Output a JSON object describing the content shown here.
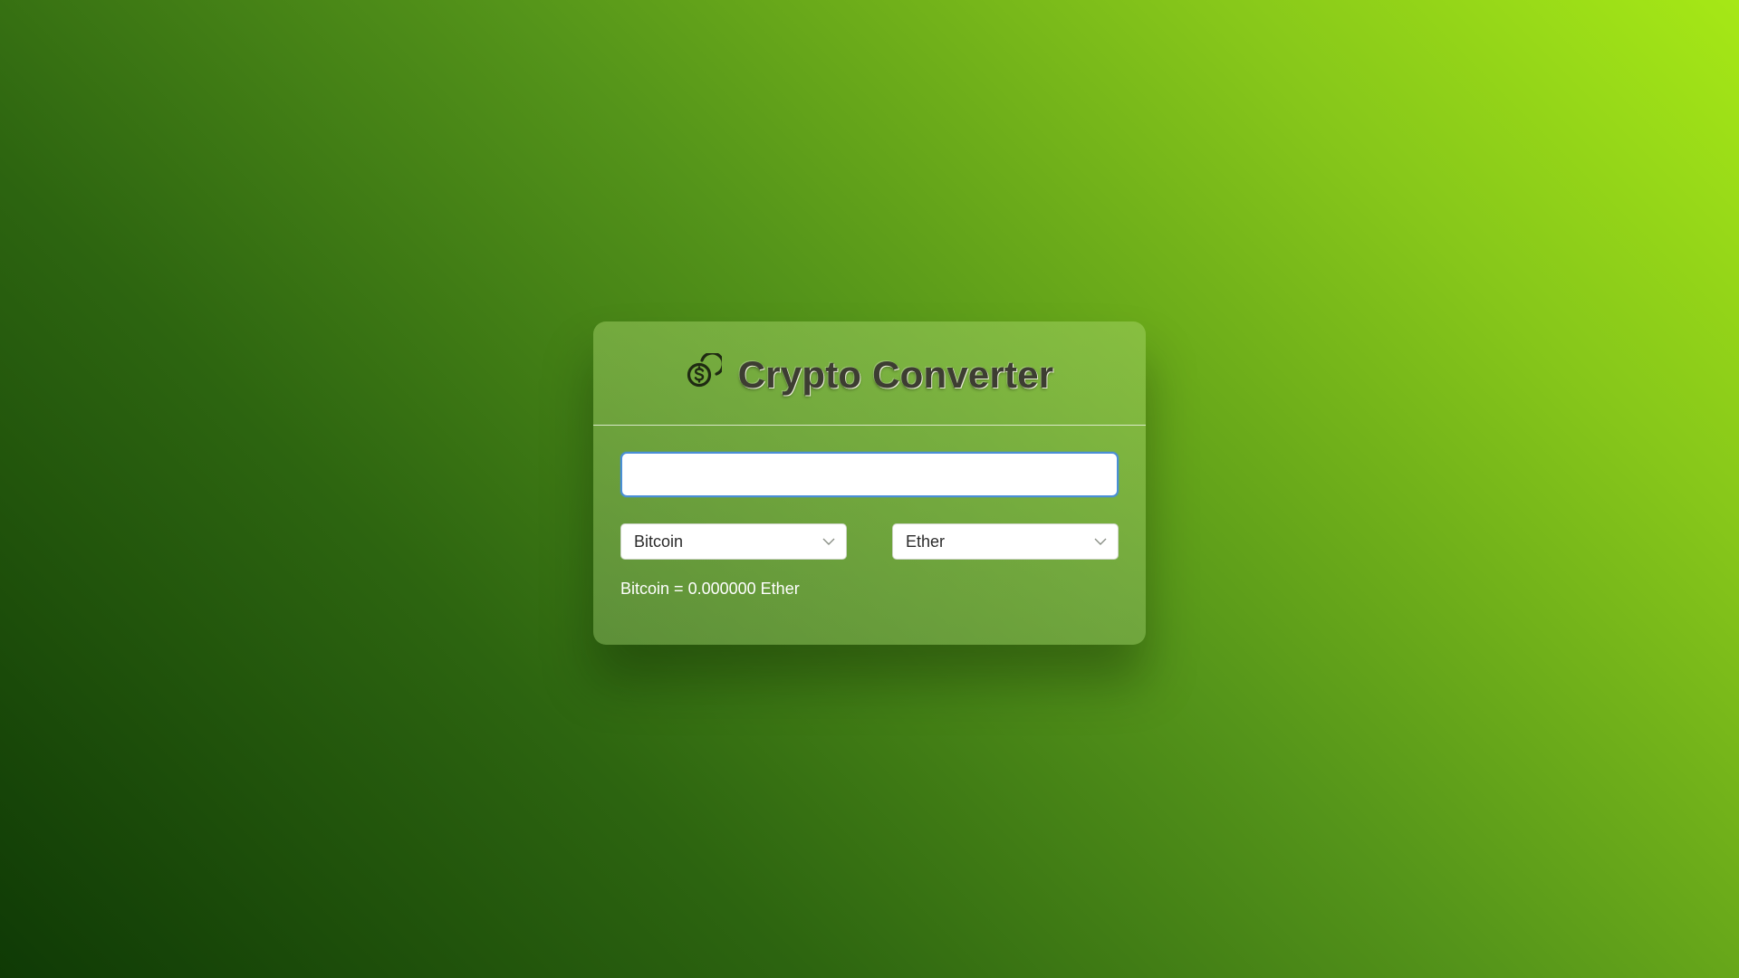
{
  "app": {
    "title": "Crypto Converter",
    "icon": "coins-icon"
  },
  "converter": {
    "amount": {
      "value": "",
      "placeholder": ""
    },
    "from_select": {
      "selected": "Bitcoin",
      "icon": "chevron-down-icon"
    },
    "to_select": {
      "selected": "Ether",
      "icon": "chevron-down-icon"
    },
    "result": {
      "from": "Bitcoin",
      "equals": "=",
      "amount": "0.000000",
      "to": "Ether"
    }
  },
  "colors": {
    "background_dark": "#0f3a05",
    "background_light": "#a6e816",
    "title_text": "#3d3d32",
    "input_focus_border": "#4a8fd6",
    "result_text": "#ffffff"
  }
}
